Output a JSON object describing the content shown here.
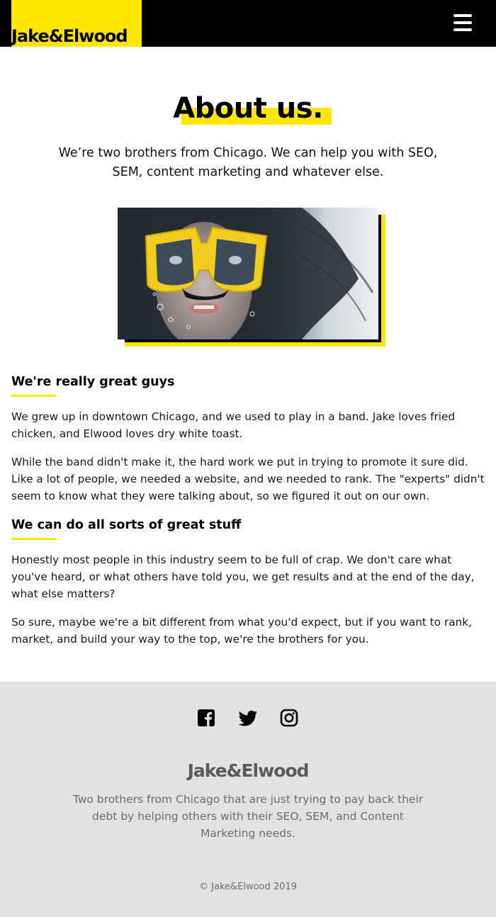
{
  "header": {
    "logo": "Jake&Elwood",
    "menu_icon": "hamburger-menu-icon"
  },
  "hero": {
    "title": "About us.",
    "intro": "We’re two brothers from Chicago. We can help you with SEO, SEM, content marketing and whatever else.",
    "image_alt": "woman with yellow diving mask underwater"
  },
  "sections": [
    {
      "heading": "We're really great guys",
      "paragraphs": [
        "We grew up in downtown Chicago, and we used to play in a band. Jake loves fried chicken, and Elwood loves dry white toast.",
        "While the band didn't make it, the hard work we put in trying to promote it sure did. Like a lot of people, we needed a website, and we needed to rank. The \"experts\" didn't seem to know what they were talking about, so we figured it out on our own."
      ]
    },
    {
      "heading": "We can do all sorts of great stuff",
      "paragraphs": [
        "Honestly most people in this industry seem to be full of crap. We don't care what you've heard, or what others have told you, we get results and at the end of the day, what else matters?",
        "So sure, maybe we're a bit different from what you'd expect, but if you want to rank, market, and build your way to the top, we're the brothers for you."
      ]
    }
  ],
  "footer": {
    "social_icons": [
      "facebook-icon",
      "twitter-icon",
      "instagram-icon"
    ],
    "logo": "Jake&Elwood",
    "description": "Two brothers from Chicago that are just trying to pay back their debt by helping others with their SEO, SEM, and Content Marketing needs.",
    "copyright": "© Jake&Elwood 2019"
  },
  "colors": {
    "accent": "#ffe600",
    "header_bg": "#000000",
    "footer_bg": "#e2e2e2"
  }
}
